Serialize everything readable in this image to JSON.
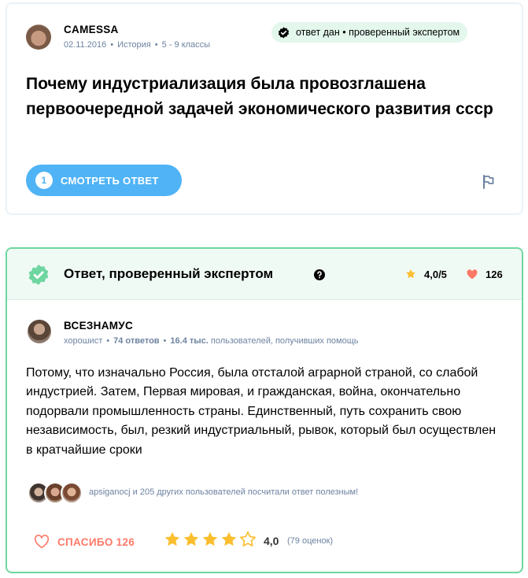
{
  "question": {
    "author": "CAMESSA",
    "date": "02.11.2016",
    "subject": "История",
    "grade": "5 - 9 классы",
    "badge": "ответ дан • проверенный экспертом",
    "title": "Почему индустриализация была провозглашена первоочередной задачей экономического развития ссср",
    "answers_count": "1",
    "view_answer_label": "СМОТРЕТЬ ОТВЕТ"
  },
  "answer": {
    "header_title": "Ответ, проверенный экспертом",
    "rating": "4,0/5",
    "likes": "126",
    "author": "ВСЕЗНАМУС",
    "rank": "хорошист",
    "answers_count": "74 ответов",
    "helped_count": "16.4 тыс.",
    "helped_label": "пользователей, получивших помощь",
    "text": "Потому, что изначально Россия, была отсталой аграрной страной, со слабой индустрией. Затем, Первая мировая, и гражданская, война, окончательно подорвали промышленность страны. Единственный, путь сохранить свою независимость, был, резкий индустриальный, рывок, который был осуществлен в кратчайшие сроки",
    "helpful_text": "apsiganocj и 205 других пользователей посчитали ответ полезным!",
    "thanks_label": "СПАСИБО 126",
    "rating_value": "4,0",
    "rating_count": "(79 оценок)",
    "stars_filled": 4,
    "stars_total": 5
  },
  "colors": {
    "accent_blue": "#4fb3f6",
    "expert_green": "#6ed6a0",
    "header_green_bg": "#f0faf5",
    "star_yellow": "#fbbe2e",
    "heart_red": "#ff7968",
    "meta_gray": "#6d83a1"
  },
  "icons": {
    "badge": "verified-badge-icon",
    "flag": "flag-icon",
    "expert": "expert-check-icon",
    "help": "help-icon",
    "star": "star-icon",
    "heart": "heart-icon"
  }
}
